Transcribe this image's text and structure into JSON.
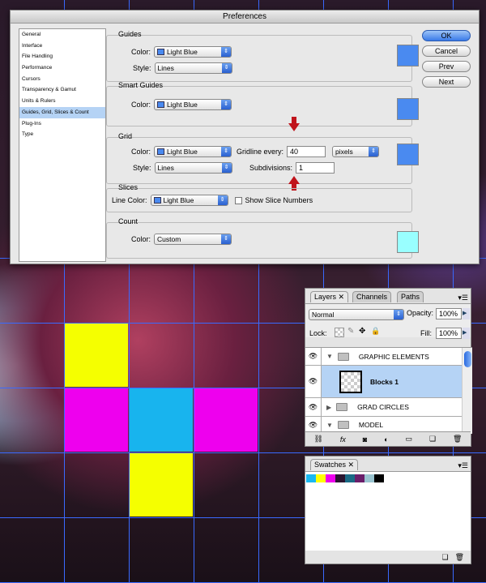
{
  "dialog": {
    "title": "Preferences",
    "sidebar": [
      "General",
      "Interface",
      "File Handling",
      "Performance",
      "Cursors",
      "Transparency & Gamut",
      "Units & Rulers",
      "Guides, Grid, Slices & Count",
      "Plug-Ins",
      "Type"
    ],
    "selected_index": 7,
    "guides": {
      "title": "Guides",
      "color_label": "Color:",
      "color": "Light Blue",
      "style_label": "Style:",
      "style": "Lines"
    },
    "smart_guides": {
      "title": "Smart Guides",
      "color_label": "Color:",
      "color": "Light Blue"
    },
    "grid": {
      "title": "Grid",
      "color_label": "Color:",
      "color": "Light Blue",
      "style_label": "Style:",
      "style": "Lines",
      "gridline_label": "Gridline every:",
      "gridline_value": "40",
      "unit": "pixels",
      "subdiv_label": "Subdivisions:",
      "subdiv_value": "1"
    },
    "slices": {
      "title": "Slices",
      "line_color_label": "Line Color:",
      "color": "Light Blue",
      "show_numbers": "Show Slice Numbers"
    },
    "count": {
      "title": "Count",
      "color_label": "Color:",
      "color": "Custom"
    },
    "buttons": {
      "ok": "OK",
      "cancel": "Cancel",
      "prev": "Prev",
      "next": "Next"
    },
    "colors": {
      "light_blue": "#4a8af0",
      "count": "#99ffff",
      "arrow": "#c0141c"
    }
  },
  "layers": {
    "tabs": [
      "Layers",
      "Channels",
      "Paths"
    ],
    "blend_mode": "Normal",
    "opacity_label": "Opacity:",
    "opacity": "100%",
    "lock_label": "Lock:",
    "fill_label": "Fill:",
    "fill": "100%",
    "items": [
      {
        "name": "GRAPHIC ELEMENTS",
        "type": "group",
        "expanded": true
      },
      {
        "name": "Blocks 1",
        "type": "layer",
        "selected": true
      },
      {
        "name": "GRAD CIRCLES",
        "type": "group",
        "expanded": false
      },
      {
        "name": "MODEL",
        "type": "group",
        "expanded": true
      }
    ]
  },
  "swatches": {
    "tab": "Swatches",
    "colors": [
      "#1ab8f0",
      "#ffff00",
      "#ee00ee",
      "#2a1530",
      "#1a6a85",
      "#6a1e6a",
      "#9ac4d0",
      "#000000"
    ]
  },
  "canvas": {
    "grid_color": "#3a6aff",
    "blocks": [
      "#f5ff00",
      "#ee00ee",
      "#18b4ee",
      "#ee00ee",
      "#f5ff00"
    ]
  }
}
